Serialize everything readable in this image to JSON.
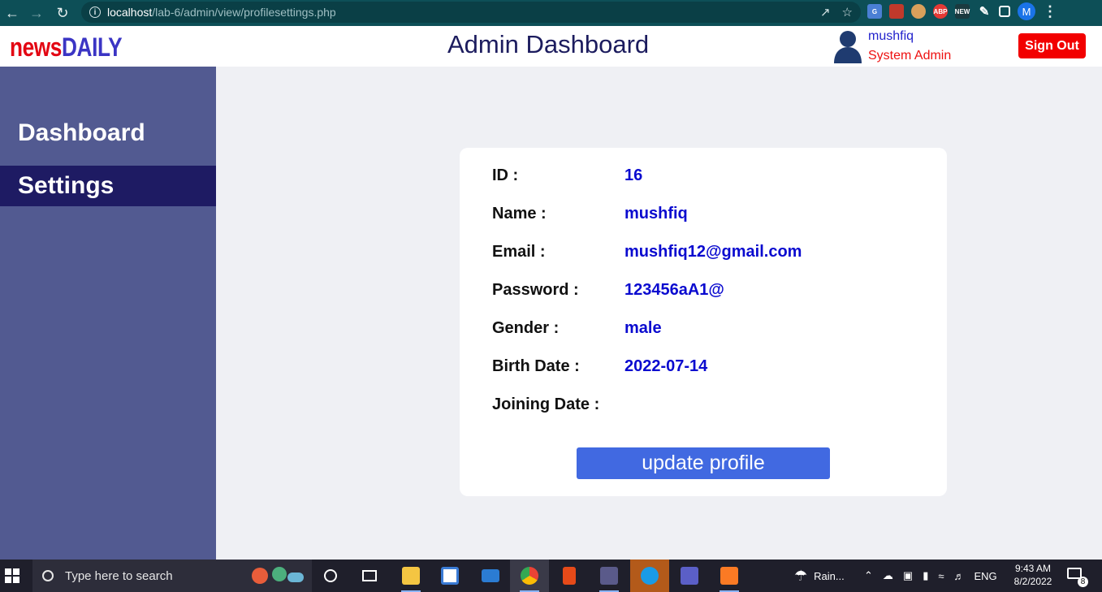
{
  "browser": {
    "url_host": "localhost",
    "url_path": "/lab-6/admin/view/profilesettings.php",
    "profile_initial": "M"
  },
  "header": {
    "logo_part1": "news",
    "logo_part2": "DAILY",
    "title": "Admin Dashboard",
    "user_name": "mushfiq",
    "user_role": "System Admin",
    "signout_label": "Sign Out"
  },
  "sidebar": {
    "items": [
      {
        "label": "Dashboard",
        "active": false
      },
      {
        "label": "Settings",
        "active": true
      }
    ]
  },
  "profile": {
    "rows": [
      {
        "label": "ID :",
        "value": "16"
      },
      {
        "label": "Name :",
        "value": "mushfiq"
      },
      {
        "label": "Email :",
        "value": "mushfiq12@gmail.com"
      },
      {
        "label": "Password :",
        "value": "123456aA1@"
      },
      {
        "label": "Gender :",
        "value": "male"
      },
      {
        "label": "Birth Date :",
        "value": "2022-07-14"
      },
      {
        "label": "Joining Date :",
        "value": ""
      }
    ],
    "button_label": "update profile"
  },
  "taskbar": {
    "search_placeholder": "Type here to search",
    "weather": "Rain...",
    "language": "ENG",
    "time": "9:43 AM",
    "date": "8/2/2022",
    "notification_count": "8"
  },
  "colors": {
    "sidebar_bg": "#525a91",
    "sidebar_active": "#1e1b63",
    "button": "#4169e1",
    "signout": "#f20000",
    "value_text": "#0a0acf"
  }
}
